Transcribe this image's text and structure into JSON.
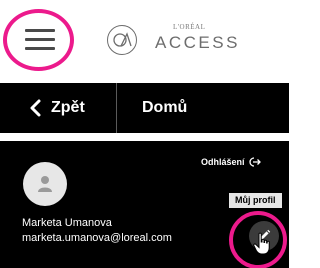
{
  "header": {
    "menu_icon": "hamburger-menu-icon",
    "logo": {
      "brand": "L'ORÉAL",
      "name": "ACCESS",
      "icon": "access-logo-icon"
    }
  },
  "navbar": {
    "back_label": "Zpět",
    "back_icon": "chevron-left-icon",
    "home_label": "Domů"
  },
  "profile": {
    "avatar_icon": "person-icon",
    "logout_label": "Odhlášení",
    "logout_icon": "logout-icon",
    "tooltip": "Můj profil",
    "name": "Marketa Umanova",
    "email": "marketa.umanova@loreal.com",
    "edit_icon": "pencil-icon"
  },
  "colors": {
    "highlight": "#ec1a8c",
    "nav_background": "#000000",
    "edit_button": "#3b3b3b"
  }
}
